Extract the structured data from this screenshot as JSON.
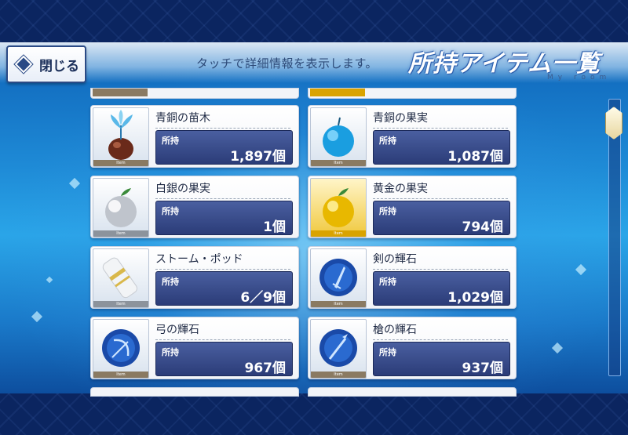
{
  "header": {
    "close_label": "閉じる",
    "hint": "タッチで詳細情報を表示します。",
    "title": "所持アイテム一覧",
    "subtitle": "My room"
  },
  "owned_label": "所持",
  "rarity_label": "Item",
  "items": [
    {
      "name": "青銅の苗木",
      "qty": "1,897個",
      "icon": "bronze-sapling-icon",
      "rarity": "bronze"
    },
    {
      "name": "青銅の果実",
      "qty": "1,087個",
      "icon": "blue-apple-icon",
      "rarity": "bronze"
    },
    {
      "name": "白銀の果実",
      "qty": "1個",
      "icon": "silver-apple-icon",
      "rarity": "silver"
    },
    {
      "name": "黄金の果実",
      "qty": "794個",
      "icon": "golden-apple-icon",
      "rarity": "gold"
    },
    {
      "name": "ストーム・ポッド",
      "qty": "6／9個",
      "icon": "storm-pod-icon",
      "rarity": "silver"
    },
    {
      "name": "剣の輝石",
      "qty": "1,029個",
      "icon": "saber-gem-icon",
      "rarity": "bronze"
    },
    {
      "name": "弓の輝石",
      "qty": "967個",
      "icon": "archer-gem-icon",
      "rarity": "bronze"
    },
    {
      "name": "槍の輝石",
      "qty": "937個",
      "icon": "lancer-gem-icon",
      "rarity": "bronze"
    }
  ],
  "colors": {
    "frame": "#0b2560",
    "count_box": "#2b3c78",
    "gold": "#d9a300",
    "bronze": "#8a7a62",
    "silver": "#8c939c"
  }
}
